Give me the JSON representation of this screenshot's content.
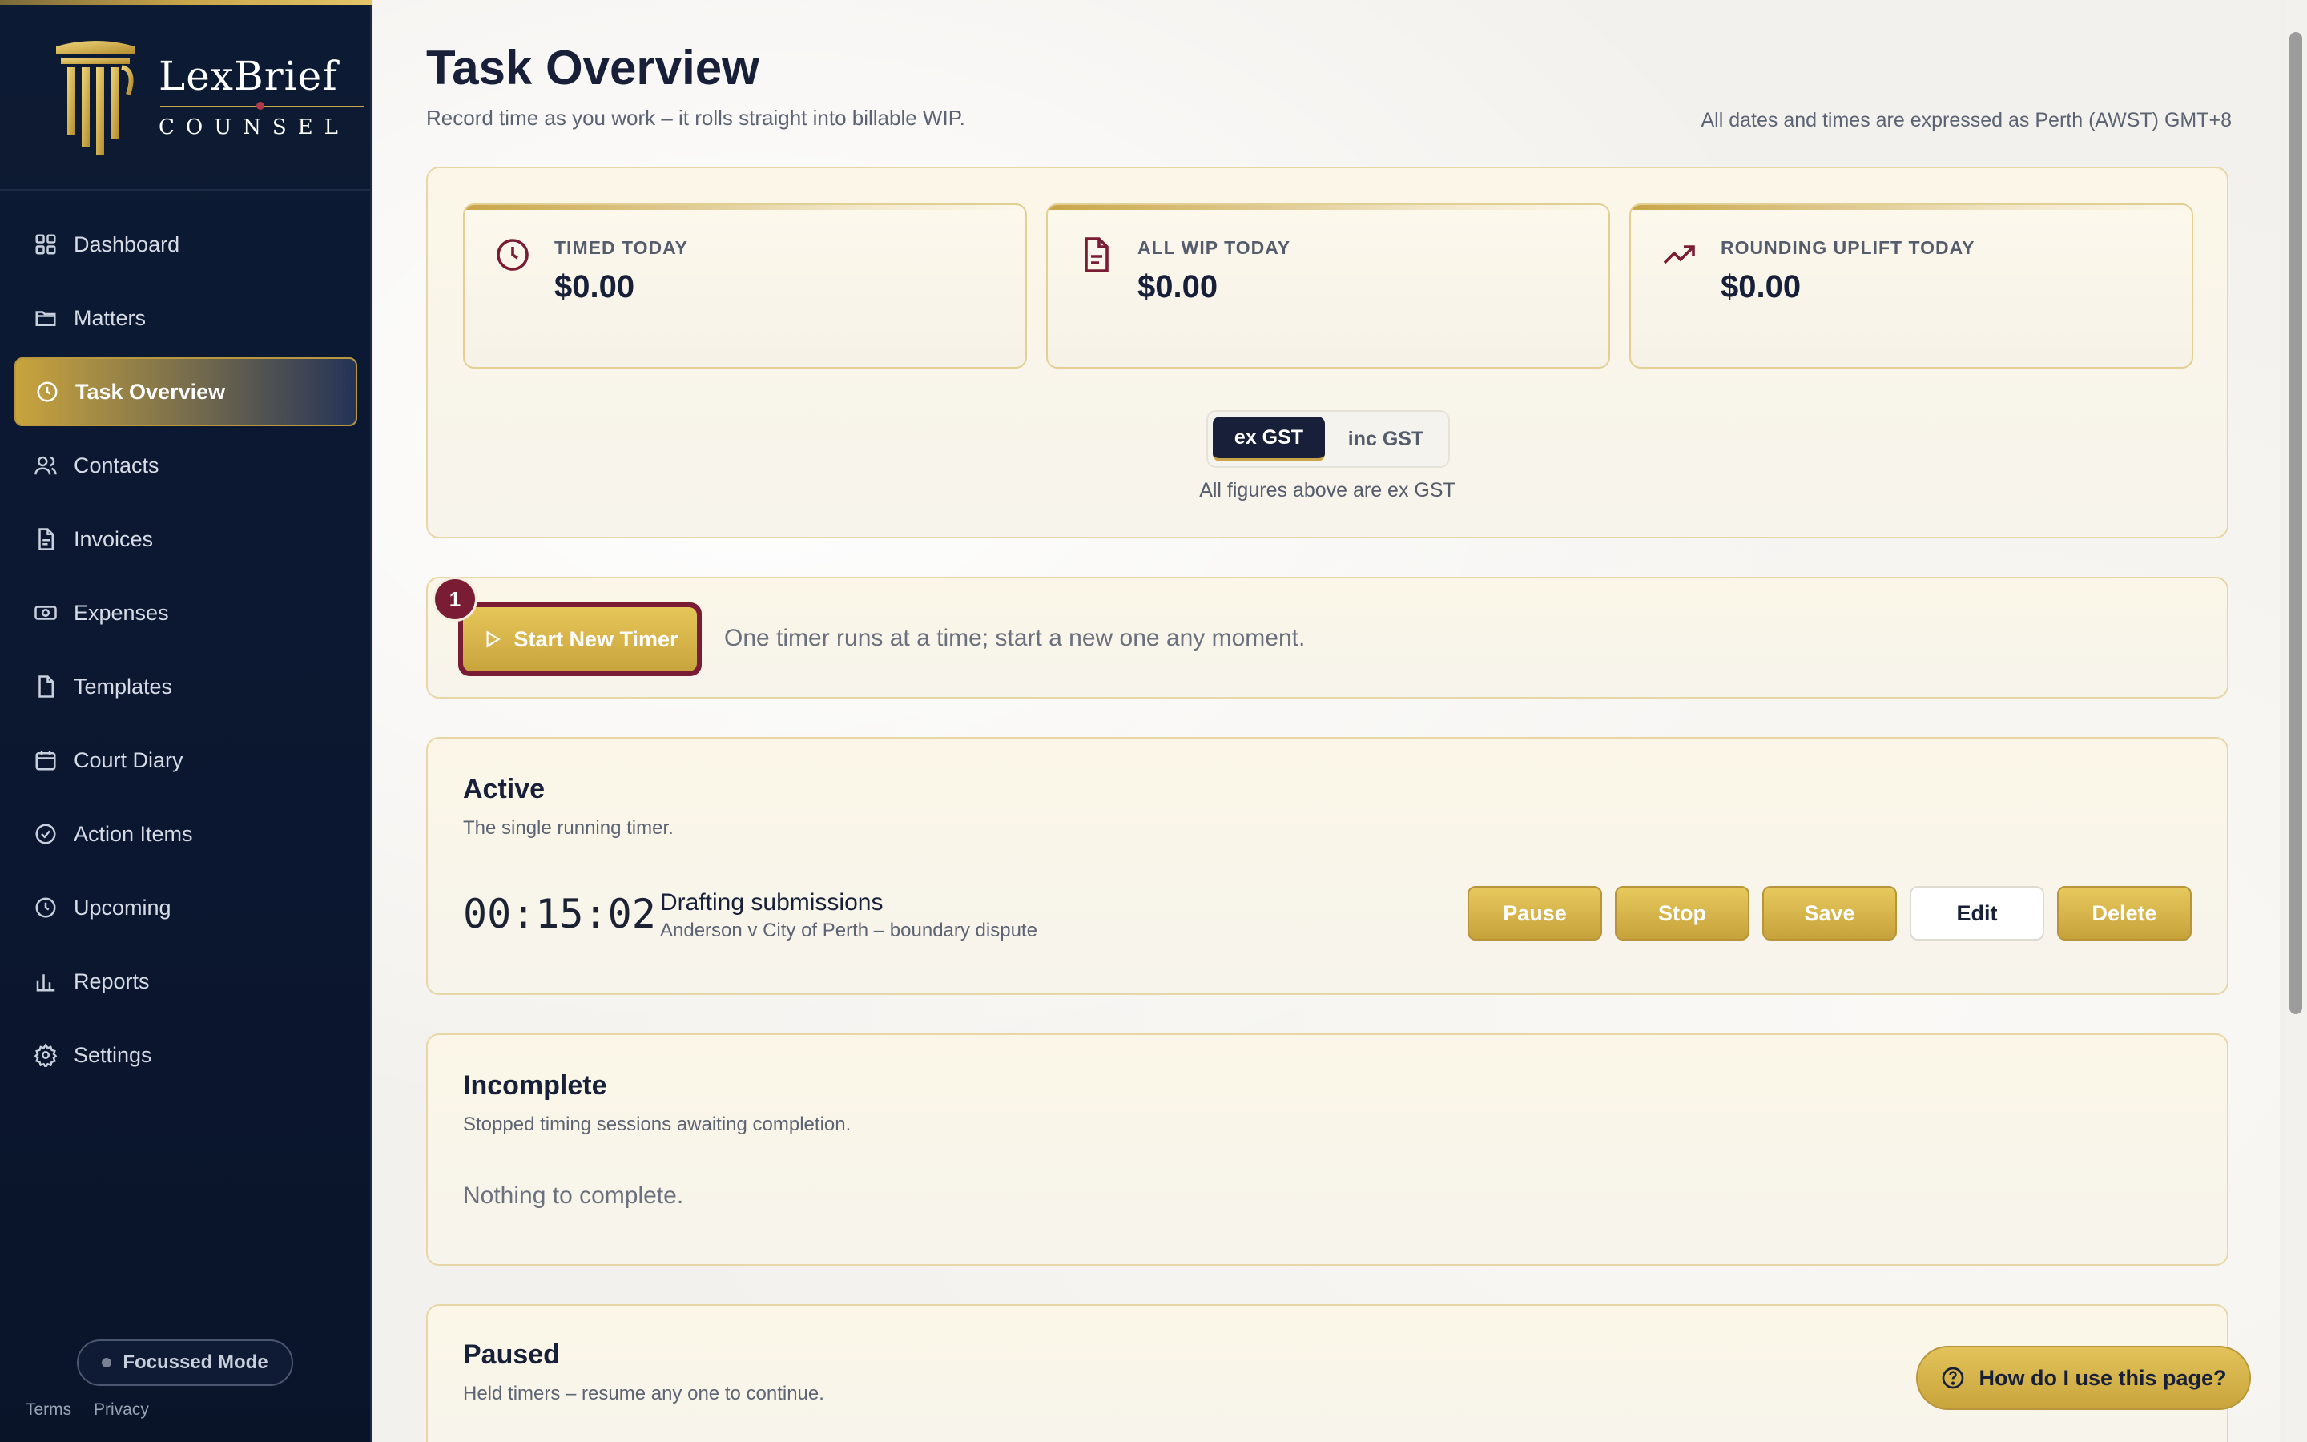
{
  "brand": {
    "name": "LexBrief",
    "subtitle": "COUNSEL"
  },
  "sidebar": {
    "items": [
      {
        "label": "Dashboard",
        "icon": "dashboard-icon"
      },
      {
        "label": "Matters",
        "icon": "folder-icon"
      },
      {
        "label": "Task Overview",
        "icon": "clock-icon",
        "active": true
      },
      {
        "label": "Contacts",
        "icon": "users-icon"
      },
      {
        "label": "Invoices",
        "icon": "file-icon"
      },
      {
        "label": "Expenses",
        "icon": "banknote-icon"
      },
      {
        "label": "Templates",
        "icon": "document-icon"
      },
      {
        "label": "Court Diary",
        "icon": "calendar-icon"
      },
      {
        "label": "Action Items",
        "icon": "check-circle-icon"
      },
      {
        "label": "Upcoming",
        "icon": "clock-icon"
      },
      {
        "label": "Reports",
        "icon": "bar-chart-icon"
      },
      {
        "label": "Settings",
        "icon": "gear-icon"
      }
    ],
    "focus_mode": "Focussed Mode",
    "footer": {
      "terms": "Terms",
      "privacy": "Privacy"
    }
  },
  "header": {
    "title": "Task Overview",
    "subtitle": "Record time as you work – it rolls straight into billable WIP.",
    "timezone_note": "All dates and times are expressed as Perth (AWST) GMT+8"
  },
  "stats": [
    {
      "label": "TIMED TODAY",
      "value": "$0.00",
      "icon": "clock-icon"
    },
    {
      "label": "ALL WIP TODAY",
      "value": "$0.00",
      "icon": "file-icon"
    },
    {
      "label": "ROUNDING UPLIFT TODAY",
      "value": "$0.00",
      "icon": "trending-up-icon"
    }
  ],
  "gst": {
    "ex": "ex GST",
    "inc": "inc GST",
    "selected": "ex GST",
    "note": "All figures above are ex GST"
  },
  "timer": {
    "start_label": "Start New Timer",
    "badge": "1",
    "hint": "One timer runs at a time; start a new one any moment."
  },
  "active": {
    "title": "Active",
    "subtitle": "The single running timer.",
    "elapsed": "00:15:02",
    "task": "Drafting submissions",
    "matter": "Anderson v City of Perth – boundary dispute",
    "buttons": {
      "pause": "Pause",
      "stop": "Stop",
      "save": "Save",
      "edit": "Edit",
      "delete": "Delete"
    }
  },
  "incomplete": {
    "title": "Incomplete",
    "subtitle": "Stopped timing sessions awaiting completion.",
    "empty": "Nothing to complete."
  },
  "paused": {
    "title": "Paused",
    "subtitle": "Held timers – resume any one to continue."
  },
  "help": {
    "label": "How do I use this page?"
  },
  "colors": {
    "navy": "#172038",
    "gold": "#c9a43d",
    "burgundy": "#7a1c33"
  }
}
